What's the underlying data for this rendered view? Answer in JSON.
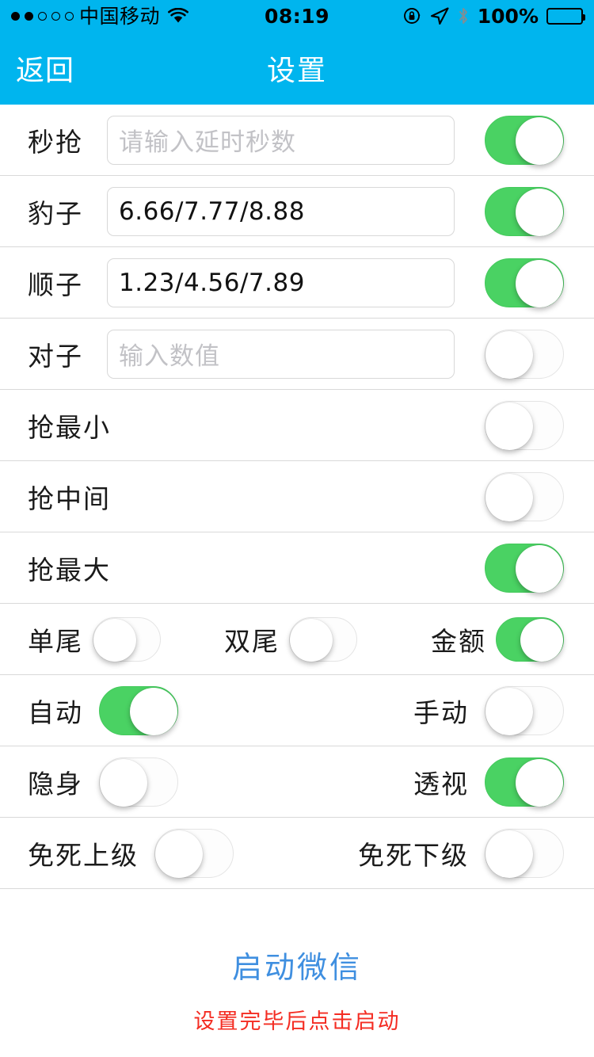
{
  "status_bar": {
    "signal_dots_filled": 2,
    "signal_dots_total": 5,
    "carrier": "中国移动",
    "wifi_icon": "wifi-icon",
    "time": "08:19",
    "rotation_lock_icon": "rotation-lock-icon",
    "location_icon": "location-arrow-icon",
    "bluetooth_icon": "bluetooth-icon",
    "battery_percent": "100%",
    "battery_level": 100,
    "bar_color": "#00b5ee"
  },
  "nav_bar": {
    "back_label": "返回",
    "title": "设置"
  },
  "theme": {
    "accent": "#00b5ee",
    "toggle_on": "#4ad263",
    "toggle_off": "#fdfdfd",
    "link_blue": "#3f8fe0",
    "warning_red": "#f42c22"
  },
  "rows": [
    {
      "type": "input",
      "label": "秒抢",
      "value": "",
      "placeholder": "请输入延时秒数",
      "toggle": true
    },
    {
      "type": "input",
      "label": "豹子",
      "value": "6.66/7.77/8.88",
      "placeholder": "",
      "toggle": true
    },
    {
      "type": "input",
      "label": "顺子",
      "value": "1.23/4.56/7.89",
      "placeholder": "",
      "toggle": true
    },
    {
      "type": "input",
      "label": "对子",
      "value": "",
      "placeholder": "输入数值",
      "toggle": false
    },
    {
      "type": "simple",
      "label": "抢最小",
      "toggle": false
    },
    {
      "type": "simple",
      "label": "抢中间",
      "toggle": false
    },
    {
      "type": "simple",
      "label": "抢最大",
      "toggle": true
    },
    {
      "type": "triple",
      "cells": [
        {
          "label": "单尾",
          "toggle": false
        },
        {
          "label": "双尾",
          "toggle": false
        },
        {
          "label": "金额",
          "toggle": true
        }
      ]
    },
    {
      "type": "dual",
      "cells": [
        {
          "label": "自动",
          "toggle": true
        },
        {
          "label": "手动",
          "toggle": false
        }
      ]
    },
    {
      "type": "dual",
      "cells": [
        {
          "label": "隐身",
          "toggle": false
        },
        {
          "label": "透视",
          "toggle": true
        }
      ]
    },
    {
      "type": "dual",
      "cells": [
        {
          "label": "免死上级",
          "toggle": false
        },
        {
          "label": "免死下级",
          "toggle": false
        }
      ]
    }
  ],
  "footer": {
    "launch_label": "启动微信",
    "hint": "设置完毕后点击启动"
  }
}
